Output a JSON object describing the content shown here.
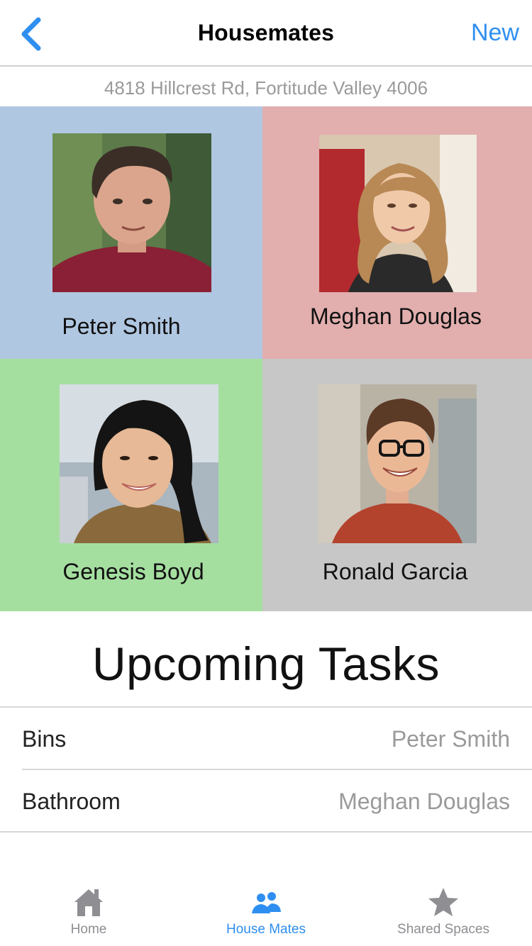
{
  "navbar": {
    "title": "Housemates",
    "right_action": "New",
    "back_icon": "chevron-left-icon"
  },
  "address": "4818 Hillcrest Rd, Fortitude Valley 4006",
  "housemates": [
    {
      "name": "Peter Smith",
      "tile_color": "#b0c7e1"
    },
    {
      "name": "Meghan Douglas",
      "tile_color": "#e2aeae"
    },
    {
      "name": "Genesis Boyd",
      "tile_color": "#a5dfa0"
    },
    {
      "name": "Ronald Garcia",
      "tile_color": "#c7c7c7"
    }
  ],
  "tasks": {
    "title": "Upcoming Tasks",
    "items": [
      {
        "task": "Bins",
        "assignee": "Peter Smith"
      },
      {
        "task": "Bathroom",
        "assignee": "Meghan Douglas"
      }
    ]
  },
  "tabbar": {
    "items": [
      {
        "label": "Home",
        "icon": "house-icon",
        "active": false
      },
      {
        "label": "House Mates",
        "icon": "people-icon",
        "active": true
      },
      {
        "label": "Shared Spaces",
        "icon": "star-icon",
        "active": false
      }
    ]
  },
  "colors": {
    "accent": "#2f8ff0",
    "inactive": "#8e8e93"
  }
}
